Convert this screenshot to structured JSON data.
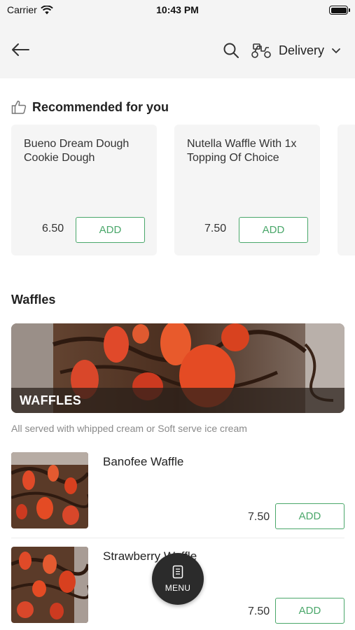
{
  "status_bar": {
    "carrier": "Carrier",
    "time": "10:43 PM"
  },
  "header": {
    "delivery_label": "Delivery",
    "icons": [
      "back-arrow-icon",
      "search-icon",
      "scooter-icon",
      "chevron-down-icon"
    ]
  },
  "recommended": {
    "title": "Recommended for you",
    "icon": "thumbs-up-icon",
    "items": [
      {
        "name": "Bueno Dream Dough Cookie Dough",
        "price": "6.50",
        "add_label": "ADD"
      },
      {
        "name": "Nutella Waffle With 1x Topping Of Choice",
        "price": "7.50",
        "add_label": "ADD"
      }
    ]
  },
  "section": {
    "title": "Waffles",
    "banner_label": "WAFFLES",
    "description": "All served with whipped cream or Soft serve ice cream"
  },
  "items": [
    {
      "name": "Banofee Waffle",
      "price": "7.50",
      "add_label": "ADD"
    },
    {
      "name": "Strawberry Waffle",
      "price": "7.50",
      "add_label": "ADD"
    }
  ],
  "menu_button": {
    "label": "MENU"
  },
  "colors": {
    "accent": "#4aa76a",
    "header_bg": "#f4f4f4",
    "card_bg": "#f5f5f5",
    "fab_bg": "#2b2b2b"
  }
}
